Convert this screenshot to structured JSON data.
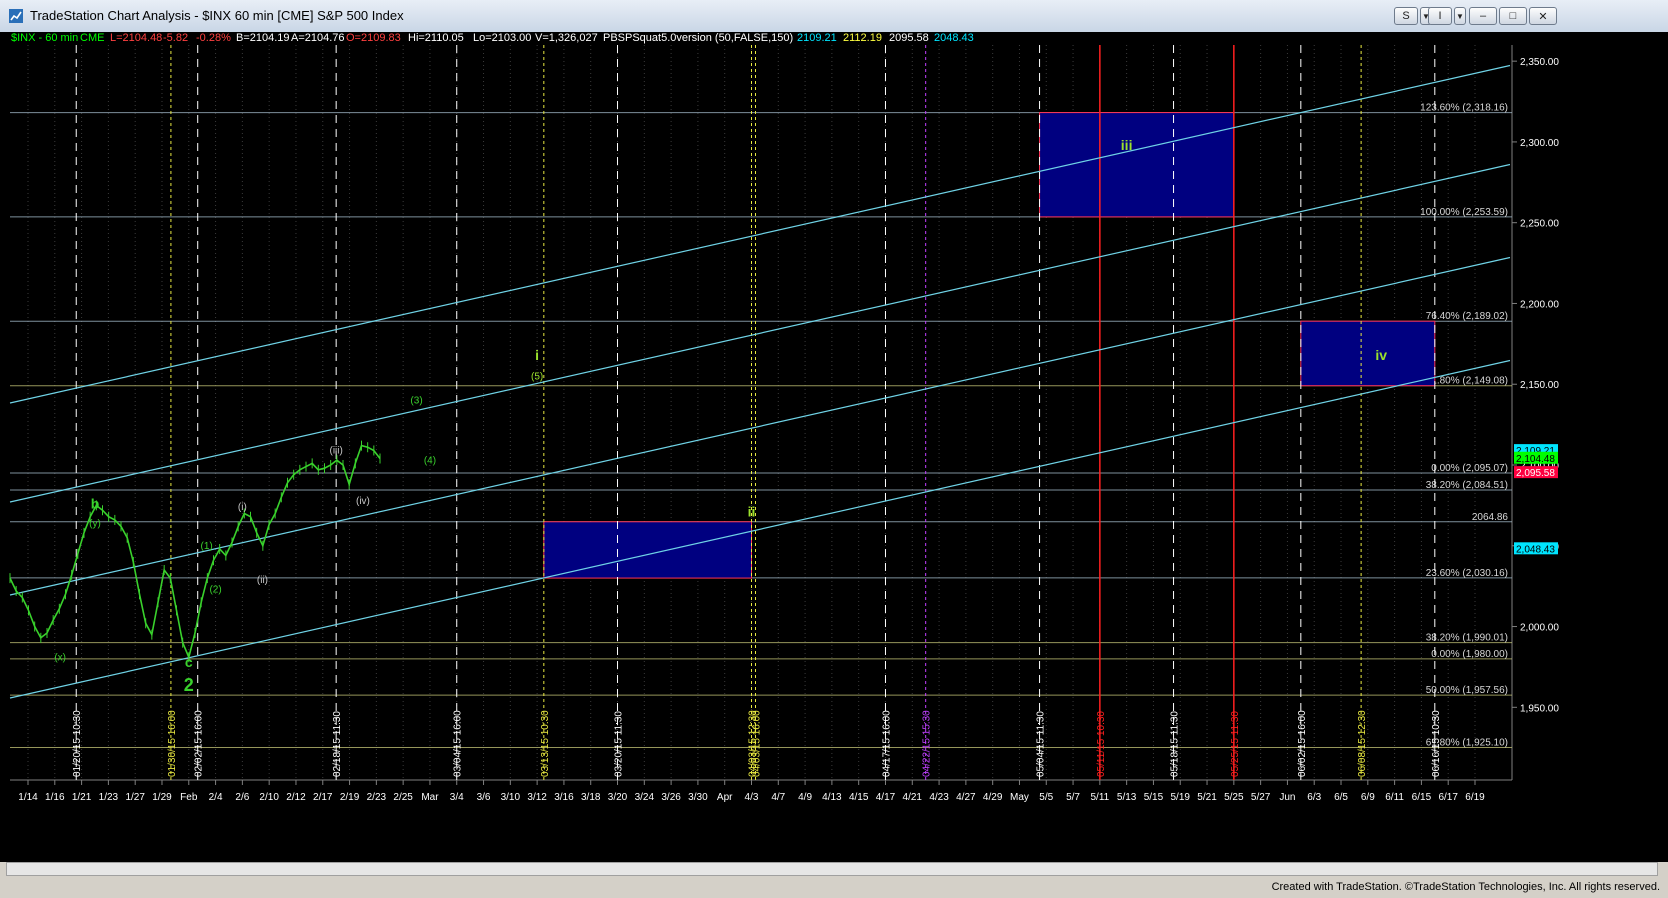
{
  "window": {
    "title": "TradeStation Chart Analysis - $INX 60 min [CME] S&P 500 Index",
    "btn_s": "S",
    "btn_i": "I",
    "btn_min": "–",
    "btn_max": "□",
    "btn_close": "✕",
    "btn_x": "✕"
  },
  "status_bar": {
    "symbol": "$INX - 60 min",
    "exchange": "CME",
    "last": "L=2104.48",
    "change": "-5.82",
    "pct": "-0.28%",
    "bid": "B=2104.19",
    "ask": "A=2104.76",
    "open": "O=2109.83",
    "high": "Hi=2110.05",
    "low": "Lo=2103.00",
    "volume": "V=1,326,027",
    "indicator": "PBSPSquat5.0version (50,FALSE,150)",
    "v1": "2109.21",
    "v2": "2112.19",
    "v3": "2095.58",
    "v4": "2048.43"
  },
  "colors": {
    "background": "#000000",
    "channel": "#6fd3e6",
    "fib_line": "#a9bfd0",
    "box_fill": "#000080",
    "box_border": "#ff3355",
    "wave_green": "#39d12c",
    "red_vline": "#ff2020",
    "price_line": "#ffffff"
  },
  "chart_data": {
    "type": "line",
    "title": "$INX 60 min [CME] S&P 500 Index",
    "ylim": [
      1905,
      2360
    ],
    "y_ticks": [
      "2,350.00",
      "2,300.00",
      "2,250.00",
      "2,200.00",
      "2,150.00",
      "2,100.00",
      "2,050.00",
      "2,000.00",
      "1,950.00"
    ],
    "x_dates": [
      "1/14",
      "1/16",
      "1/21",
      "1/23",
      "1/27",
      "1/29",
      "Feb",
      "2/4",
      "2/6",
      "2/10",
      "2/12",
      "2/17",
      "2/19",
      "2/23",
      "2/25",
      "Mar",
      "3/4",
      "3/6",
      "3/10",
      "3/12",
      "3/16",
      "3/18",
      "3/20",
      "3/24",
      "3/26",
      "3/30",
      "Apr",
      "4/3",
      "4/7",
      "4/9",
      "4/13",
      "4/15",
      "4/17",
      "4/21",
      "4/23",
      "4/27",
      "4/29",
      "May",
      "5/5",
      "5/7",
      "5/11",
      "5/13",
      "5/15",
      "5/19",
      "5/21",
      "5/25",
      "5/27",
      "Jun",
      "6/3",
      "6/5",
      "6/9",
      "6/11",
      "6/15",
      "6/17",
      "6/19"
    ],
    "series": [
      {
        "values": [
          2030,
          2022,
          2018,
          2010,
          2000,
          1993,
          1996,
          2004,
          2011,
          2020,
          2032,
          2045,
          2058,
          2068,
          2075,
          2072,
          2068,
          2066,
          2062,
          2055,
          2040,
          2020,
          2002,
          1995,
          2015,
          2035,
          2030,
          2010,
          1990,
          1981,
          1996,
          2015,
          2030,
          2041,
          2048,
          2044,
          2052,
          2062,
          2070,
          2068,
          2058,
          2050,
          2063,
          2070,
          2080,
          2089,
          2094,
          2097,
          2099,
          2101,
          2097,
          2098,
          2100,
          2103,
          2100,
          2088,
          2101,
          2112,
          2111,
          2109,
          2104
        ]
      }
    ],
    "fib_levels": [
      {
        "label": "123.60% (2,318.16)",
        "value": 2318.16
      },
      {
        "label": "100.00% (2,253.59)",
        "value": 2253.59
      },
      {
        "label": "76.40% (2,189.02)",
        "value": 2189.02
      },
      {
        "label": "61.80% (2,149.08)",
        "value": 2149.08
      },
      {
        "label": "0.00% (2,095.07)",
        "value": 2095.07
      },
      {
        "label": "38.20% (2,084.51)",
        "value": 2084.51
      },
      {
        "label": "2064.86",
        "value": 2064.86
      },
      {
        "label": "23.60% (2,030.16)",
        "value": 2030.16
      },
      {
        "label": "38.20% (1,990.01)",
        "value": 1990.01
      },
      {
        "label": "0.00% (1,980.00)",
        "value": 1980.0
      },
      {
        "label": "50.00% (1,957.56)",
        "value": 1957.56
      },
      {
        "label": "61.80% (1,925.10)",
        "value": 1925.1
      }
    ],
    "price_tags": [
      {
        "label": "2,109.21",
        "value": 2109.21,
        "bg": "#00e5ff",
        "color": "#000000"
      },
      {
        "label": "2,104.48",
        "value": 2104.48,
        "bg": "#00ff00",
        "color": "#000000"
      },
      {
        "label": "2,095.58",
        "value": 2095.58,
        "bg": "#ff0040",
        "color": "#ffffff"
      },
      {
        "label": "2,048.43",
        "value": 2048.43,
        "bg": "#00e5ff",
        "color": "#000000"
      }
    ],
    "vertical_markers": [
      {
        "label": "01/20/15 10:30",
        "date": "1/20"
      },
      {
        "label": "01/30/15 16:00",
        "date": "1/30"
      },
      {
        "label": "02/02/15 16:00",
        "date": "2/2"
      },
      {
        "label": "02/18/15 11:30",
        "date": "2/18"
      },
      {
        "label": "03/04/15 16:00",
        "date": "3/4"
      },
      {
        "label": "03/13/15 10:30",
        "date": "3/13"
      },
      {
        "label": "03/20/15 11:30",
        "date": "3/20"
      },
      {
        "label": "04/03/15 12:30",
        "date": "4/3"
      },
      {
        "label": "04/03/15 16:00",
        "date": "4/3b"
      },
      {
        "label": "04/17/15 16:00",
        "date": "4/17"
      },
      {
        "label": "04/22/15 15:30",
        "date": "4/22"
      },
      {
        "label": "05/04/15 11:30",
        "date": "5/4"
      },
      {
        "label": "05/11/15 10:30",
        "date": "5/11"
      },
      {
        "label": "05/18/15 11:30",
        "date": "5/18"
      },
      {
        "label": "05/25/15 11:30",
        "date": "5/25"
      },
      {
        "label": "06/02/15 16:00",
        "date": "6/2"
      },
      {
        "label": "06/08/15 12:30",
        "date": "6/8"
      },
      {
        "label": "06/16/15 10:30",
        "date": "6/16"
      }
    ],
    "target_boxes": [
      {
        "label": "ii",
        "from": "3/13",
        "to": "4/3",
        "low": 2030,
        "high": 2064.86
      },
      {
        "label": "iii",
        "from": "5/4",
        "to": "5/25",
        "low": 2253.59,
        "high": 2318.16
      },
      {
        "label": "iv",
        "from": "6/2",
        "to": "6/16",
        "low": 2149.08,
        "high": 2189.02
      }
    ],
    "wave_labels": [
      {
        "text": "b",
        "date": "1/22",
        "price": 2073
      },
      {
        "text": "(y)",
        "date": "1/22",
        "price": 2062
      },
      {
        "text": "(x)",
        "date": "1/17",
        "price": 1979
      },
      {
        "text": "c",
        "date": "2/1",
        "price": 1975
      },
      {
        "text": "2",
        "date": "2/1",
        "price": 1960
      },
      {
        "text": "(1)",
        "date": "2/3",
        "price": 2048
      },
      {
        "text": "(2)",
        "date": "2/4",
        "price": 2021
      },
      {
        "text": "(i)",
        "date": "2/6",
        "price": 2072
      },
      {
        "text": "(ii)",
        "date": "2/9",
        "price": 2027
      },
      {
        "text": "(iii)",
        "date": "2/18",
        "price": 2107
      },
      {
        "text": "(iv)",
        "date": "2/21",
        "price": 2076
      },
      {
        "text": "(3)",
        "date": "2/27",
        "price": 2138
      },
      {
        "text": "(4)",
        "date": "3/1",
        "price": 2101
      },
      {
        "text": "i",
        "date": "3/12",
        "price": 2165
      },
      {
        "text": "(5)",
        "date": "3/12",
        "price": 2153
      },
      {
        "text": "ii",
        "date": "4/3",
        "price": 2068
      },
      {
        "text": "iii",
        "date": "5/13",
        "price": 2295
      },
      {
        "text": "iv",
        "date": "6/10",
        "price": 2165
      }
    ]
  },
  "footer": {
    "credit": "Created with TradeStation. ©TradeStation Technologies, Inc. All rights reserved."
  }
}
